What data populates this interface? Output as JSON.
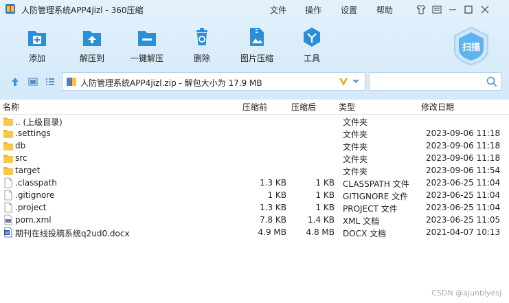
{
  "window": {
    "title": "人防管理系统APP4jizl - 360压缩",
    "menu": [
      "文件",
      "操作",
      "设置",
      "帮助"
    ]
  },
  "toolbar": {
    "buttons": [
      {
        "label": "添加",
        "icon": "add-icon"
      },
      {
        "label": "解压到",
        "icon": "extract-to-icon"
      },
      {
        "label": "一键解压",
        "icon": "one-click-extract-icon"
      },
      {
        "label": "删除",
        "icon": "delete-icon"
      },
      {
        "label": "图片压缩",
        "icon": "image-compress-icon"
      },
      {
        "label": "工具",
        "icon": "tools-icon"
      }
    ],
    "scan_label": "扫描"
  },
  "address": {
    "path": "人防管理系统APP4jizl.zip - 解包大小为 17.9 MB"
  },
  "columns": [
    "名称",
    "压缩前",
    "压缩后",
    "类型",
    "修改日期"
  ],
  "files": [
    {
      "name": ".. (上级目录)",
      "before": "",
      "after": "",
      "type": "文件夹",
      "date": "",
      "kind": "folder"
    },
    {
      "name": ".settings",
      "before": "",
      "after": "",
      "type": "文件夹",
      "date": "2023-09-06 11:18",
      "kind": "folder"
    },
    {
      "name": "db",
      "before": "",
      "after": "",
      "type": "文件夹",
      "date": "2023-09-06 11:18",
      "kind": "folder"
    },
    {
      "name": "src",
      "before": "",
      "after": "",
      "type": "文件夹",
      "date": "2023-09-06 11:18",
      "kind": "folder"
    },
    {
      "name": "target",
      "before": "",
      "after": "",
      "type": "文件夹",
      "date": "2023-09-06 11:54",
      "kind": "folder"
    },
    {
      "name": ".classpath",
      "before": "1.3 KB",
      "after": "1 KB",
      "type": "CLASSPATH 文件",
      "date": "2023-06-25 11:04",
      "kind": "file"
    },
    {
      "name": ".gitignore",
      "before": "1 KB",
      "after": "1 KB",
      "type": "GITIGNORE 文件",
      "date": "2023-06-25 11:04",
      "kind": "file"
    },
    {
      "name": ".project",
      "before": "1.3 KB",
      "after": "1 KB",
      "type": "PROJECT 文件",
      "date": "2023-06-25 11:04",
      "kind": "file"
    },
    {
      "name": "pom.xml",
      "before": "7.8 KB",
      "after": "1.4 KB",
      "type": "XML 文档",
      "date": "2023-06-25 11:05",
      "kind": "xml"
    },
    {
      "name": "期刊在线投稿系统q2ud0.docx",
      "before": "4.9 MB",
      "after": "4.8 MB",
      "type": "DOCX 文档",
      "date": "2021-04-07 10:13",
      "kind": "docx"
    }
  ],
  "watermark": "CSDN @ajunbiyesj",
  "colors": {
    "accent": "#2a8fd8",
    "folder": "#f2b731",
    "toolbar_bg": "#dcedfb"
  }
}
